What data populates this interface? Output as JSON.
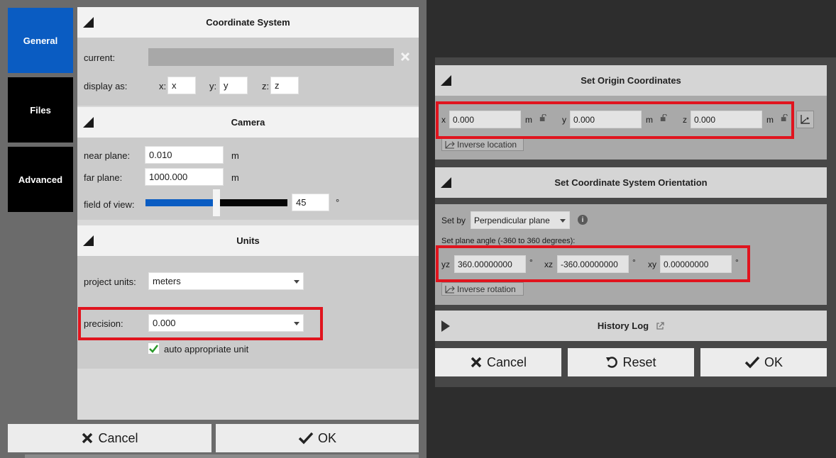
{
  "left_dialog": {
    "tabs": [
      {
        "label": "General"
      },
      {
        "label": "Files"
      },
      {
        "label": "Advanced"
      }
    ],
    "coordinate_system": {
      "title": "Coordinate System",
      "current_label": "current:",
      "current_value": "",
      "display_as_label": "display as:",
      "x_label": "x:",
      "x_value": "x",
      "y_label": "y:",
      "y_value": "y",
      "z_label": "z:",
      "z_value": "z"
    },
    "camera": {
      "title": "Camera",
      "near_plane_label": "near plane:",
      "near_plane_value": "0.010",
      "near_unit": "m",
      "far_plane_label": "far plane:",
      "far_plane_value": "1000.000",
      "far_unit": "m",
      "fov_label": "field of view:",
      "fov_value": "45",
      "fov_unit": "°",
      "fov_fraction": 0.5
    },
    "units": {
      "title": "Units",
      "project_units_label": "project units:",
      "project_units_value": "meters",
      "precision_label": "precision:",
      "precision_value": "0.000",
      "auto_unit_label": "auto appropriate unit",
      "auto_unit_checked": true
    },
    "cancel_label": "Cancel",
    "ok_label": "OK"
  },
  "right_dialog": {
    "origin": {
      "title": "Set Origin Coordinates",
      "x_label": "x",
      "x_value": "0.000",
      "y_label": "y",
      "y_value": "0.000",
      "z_label": "z",
      "z_value": "0.000",
      "unit": "m",
      "inverse_location_label": "Inverse location"
    },
    "orientation": {
      "title": "Set Coordinate System Orientation",
      "set_by_label": "Set by",
      "set_by_value": "Perpendicular plane",
      "plane_angle_label": "Set plane angle (-360 to 360 degrees):",
      "yz_label": "yz",
      "yz_value": "360.00000000",
      "xz_label": "xz",
      "xz_value": "-360.00000000",
      "xy_label": "xy",
      "xy_value": "0.00000000",
      "deg": "°",
      "inverse_rotation_label": "Inverse rotation"
    },
    "history": {
      "title": "History Log"
    },
    "cancel_label": "Cancel",
    "reset_label": "Reset",
    "ok_label": "OK"
  },
  "colors": {
    "accent_blue": "#0a5cc2",
    "highlight_red": "#e0141e",
    "check_green": "#2a9a2a"
  }
}
